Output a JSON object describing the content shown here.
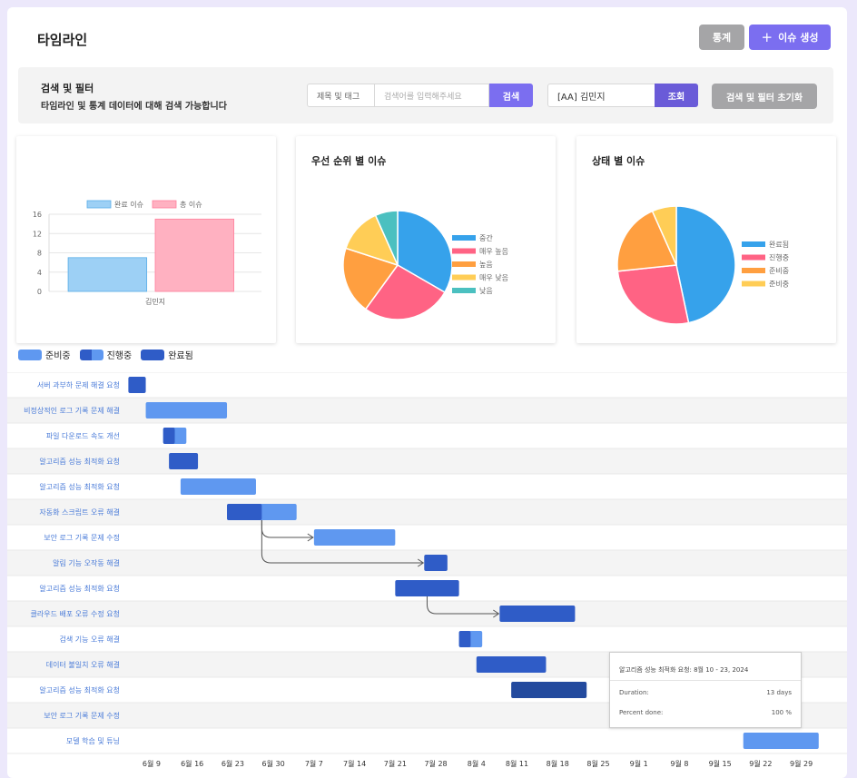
{
  "header": {
    "title": "타임라인",
    "stats_label": "통계",
    "create_label": "이슈 생성",
    "create_icon": "plus-icon"
  },
  "search": {
    "title": "검색 및 필터",
    "subtitle": "타임라인 및 통계 데이터에 대해 검색 가능합니다",
    "field_select": "제목 및 태그",
    "keyword_placeholder": "검색어를 입력해주세요",
    "search_label": "검색",
    "assignee_value": "[AA] 김민지",
    "query_label": "조회",
    "reset_label": "검색 및 필터 초기화"
  },
  "chart_data": [
    {
      "type": "bar",
      "title": "",
      "categories": [
        "김민지"
      ],
      "series": [
        {
          "name": "완료 이슈",
          "values": [
            7
          ],
          "color": "#9dd0f5"
        },
        {
          "name": "총 이슈",
          "values": [
            15
          ],
          "color": "#ffb1c1"
        }
      ],
      "ylim": [
        0,
        16
      ],
      "yticks": [
        0,
        4,
        8,
        12,
        16
      ],
      "legend": "top"
    },
    {
      "type": "pie",
      "title": "우선 순위 별 이슈",
      "labels": [
        "중간",
        "매우 높음",
        "높음",
        "매우 낮음",
        "낮음"
      ],
      "values": [
        5,
        4,
        3,
        2,
        1
      ],
      "colors": [
        "#36a2eb",
        "#ff6384",
        "#ff9f40",
        "#ffcd56",
        "#4bc0c0"
      ],
      "legend": "right"
    },
    {
      "type": "pie",
      "title": "상태 별 이슈",
      "labels": [
        "완료됨",
        "진행중",
        "준비중",
        "준비중"
      ],
      "values": [
        7,
        4,
        3,
        1
      ],
      "colors": [
        "#36a2eb",
        "#ff6384",
        "#ff9f40",
        "#ffcd56"
      ],
      "legend": "right"
    }
  ],
  "gantt": {
    "legend": [
      {
        "label": "준비중",
        "type": "todo"
      },
      {
        "label": "진행중",
        "type": "progress"
      },
      {
        "label": "완료됨",
        "type": "done"
      }
    ],
    "colors": {
      "todo": "#5f98f0",
      "done": "#2f5cc7",
      "selected": "#234a9e",
      "arrow": "#555555"
    },
    "axis_start": "2024-06-04",
    "ticks": [
      "6월 9",
      "6월 16",
      "6월 23",
      "6월 30",
      "7월 7",
      "7월 14",
      "7월 21",
      "7월 28",
      "8월 4",
      "8월 11",
      "8월 18",
      "8월 25",
      "9월 1",
      "9월 8",
      "9월 15",
      "9월 22",
      "9월 29"
    ],
    "tasks": [
      {
        "name": "서버 과부하 문제 해결 요청",
        "start": "2024-06-05",
        "end": "2024-06-08",
        "progress": 100
      },
      {
        "name": "비정상적인 로그 기록 문제 해결",
        "start": "2024-06-08",
        "end": "2024-06-22",
        "progress": 0
      },
      {
        "name": "파일 다운로드 속도 개선",
        "start": "2024-06-11",
        "end": "2024-06-15",
        "progress": 50
      },
      {
        "name": "알고리즘 성능 최적화 요청",
        "start": "2024-06-12",
        "end": "2024-06-17",
        "progress": 100
      },
      {
        "name": "알고리즘 성능 최적화 요청",
        "start": "2024-06-14",
        "end": "2024-06-27",
        "progress": 0
      },
      {
        "name": "자동화 스크립트 오류 해결",
        "start": "2024-06-22",
        "end": "2024-07-04",
        "progress": 50
      },
      {
        "name": "보안 로그 기록 문제 수정",
        "start": "2024-07-07",
        "end": "2024-07-21",
        "progress": 0
      },
      {
        "name": "알림 기능 오작동 해결",
        "start": "2024-07-26",
        "end": "2024-07-30",
        "progress": 100
      },
      {
        "name": "알고리즘 성능 최적화 요청",
        "start": "2024-07-21",
        "end": "2024-08-01",
        "progress": 100
      },
      {
        "name": "클라우드 배포 오류 수정 요청",
        "start": "2024-08-08",
        "end": "2024-08-21",
        "progress": 100
      },
      {
        "name": "검색 기능 오류 해결",
        "start": "2024-08-01",
        "end": "2024-08-05",
        "progress": 50
      },
      {
        "name": "데이터 불일치 오류 해결",
        "start": "2024-08-04",
        "end": "2024-08-16",
        "progress": 100
      },
      {
        "name": "알고리즘 성능 최적화 요청",
        "start": "2024-08-10",
        "end": "2024-08-23",
        "progress": 100,
        "selected": true
      },
      {
        "name": "보안 로그 기록 문제 수정",
        "start": "",
        "end": "",
        "progress": 0
      },
      {
        "name": "모델 학습 및 튜닝",
        "start": "2024-09-19",
        "end": "2024-10-02",
        "progress": 0
      }
    ],
    "dependencies": [
      [
        5,
        6
      ],
      [
        5,
        7
      ],
      [
        8,
        9
      ]
    ]
  },
  "tooltip": {
    "title": "알고리즘 성능 최적화 요청: 8월 10 - 23, 2024",
    "duration_label": "Duration:",
    "duration_value": "13 days",
    "percent_label": "Percent done:",
    "percent_value": "100 %"
  }
}
